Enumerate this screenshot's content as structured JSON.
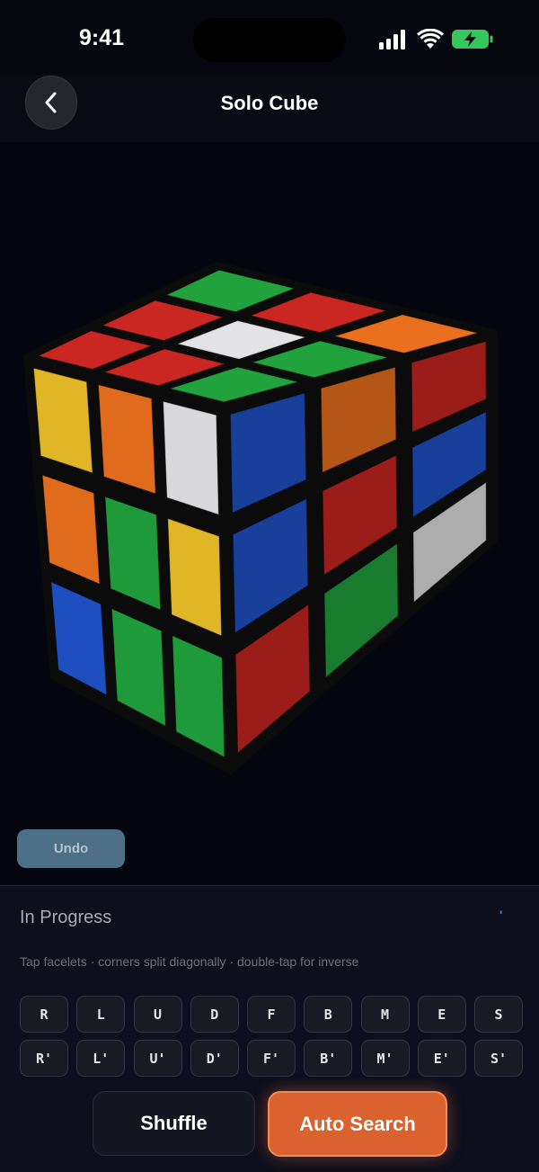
{
  "status_bar": {
    "time": "9:41",
    "icons": [
      "cellular-signal-icon",
      "wifi-icon",
      "battery-charging-icon"
    ]
  },
  "nav": {
    "back_icon": "chevron-left-icon",
    "title": "Solo Cube"
  },
  "cube": {
    "colors": {
      "W": "#d8d8da",
      "Y": "#e0b526",
      "R": "#c02420",
      "O": "#e06b1c",
      "B": "#1e4fc0",
      "G": "#1f9a3a"
    },
    "top_face": [
      "R",
      "R",
      "G",
      "R",
      "W",
      "R",
      "G",
      "G",
      "O"
    ],
    "front_face": [
      "Y",
      "O",
      "W",
      "O",
      "G",
      "Y",
      "B",
      "G",
      "G"
    ],
    "right_face": [
      "B",
      "O",
      "R",
      "B",
      "R",
      "B",
      "R",
      "G",
      "W"
    ]
  },
  "undo_label": "Undo",
  "panel": {
    "state_label": "In Progress",
    "tick": "'",
    "hint": "Tap facelets · corners split diagonally · double-tap for inverse",
    "moves": [
      "R",
      "L",
      "U",
      "D",
      "F",
      "B",
      "M",
      "E",
      "S"
    ],
    "inverse_moves": [
      "R'",
      "L'",
      "U'",
      "D'",
      "F'",
      "B'",
      "M'",
      "E'",
      "S'"
    ]
  },
  "actions": {
    "shuffle_label": "Shuffle",
    "auto_search_label": "Auto Search"
  }
}
